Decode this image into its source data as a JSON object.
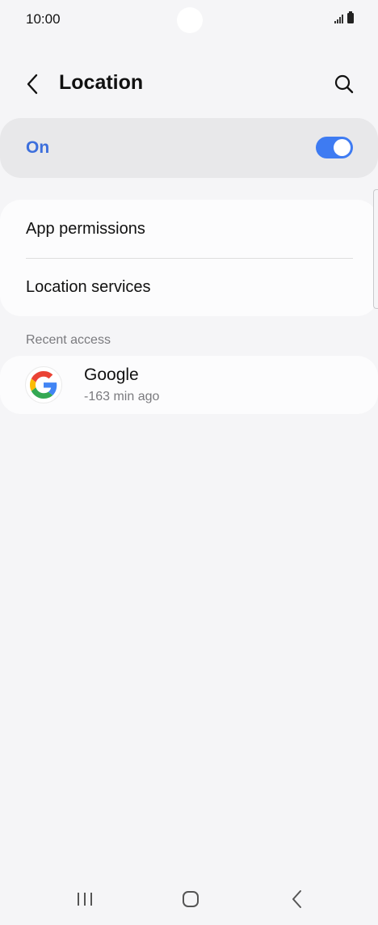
{
  "status_bar": {
    "time": "10:00",
    "icons": [
      "signal-icon",
      "battery-icon"
    ]
  },
  "header": {
    "title": "Location",
    "back_icon": "chevron-left-icon",
    "search_icon": "search-icon"
  },
  "location_toggle": {
    "label": "On",
    "state": "on",
    "accent_color": "#3e7bf2",
    "label_color": "#3d6fdc"
  },
  "menu": {
    "items": [
      {
        "label": "App permissions"
      },
      {
        "label": "Location services"
      }
    ]
  },
  "recent_access": {
    "section_label": "Recent access",
    "items": [
      {
        "app_name": "Google",
        "time": "-163 min ago",
        "icon": "google-icon"
      }
    ]
  },
  "nav_bar": {
    "icons": [
      "recent-apps-icon",
      "home-icon",
      "back-icon"
    ]
  }
}
